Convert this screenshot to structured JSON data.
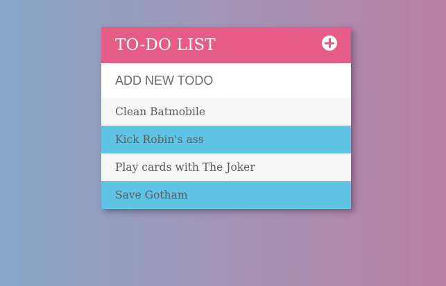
{
  "header": {
    "title": "TO-DO LIST",
    "add_icon": "plus-circle-icon"
  },
  "new_todo": {
    "placeholder": "ADD NEW TODO"
  },
  "colors": {
    "header": "#e55c86",
    "item_light": "#f6f6f6",
    "item_highlight": "#5fc3e4",
    "text": "#5c5c5c"
  },
  "todos": [
    {
      "text": "Clean Batmobile"
    },
    {
      "text": "Kick Robin's ass"
    },
    {
      "text": "Play cards with The Joker"
    },
    {
      "text": "Save Gotham"
    }
  ]
}
